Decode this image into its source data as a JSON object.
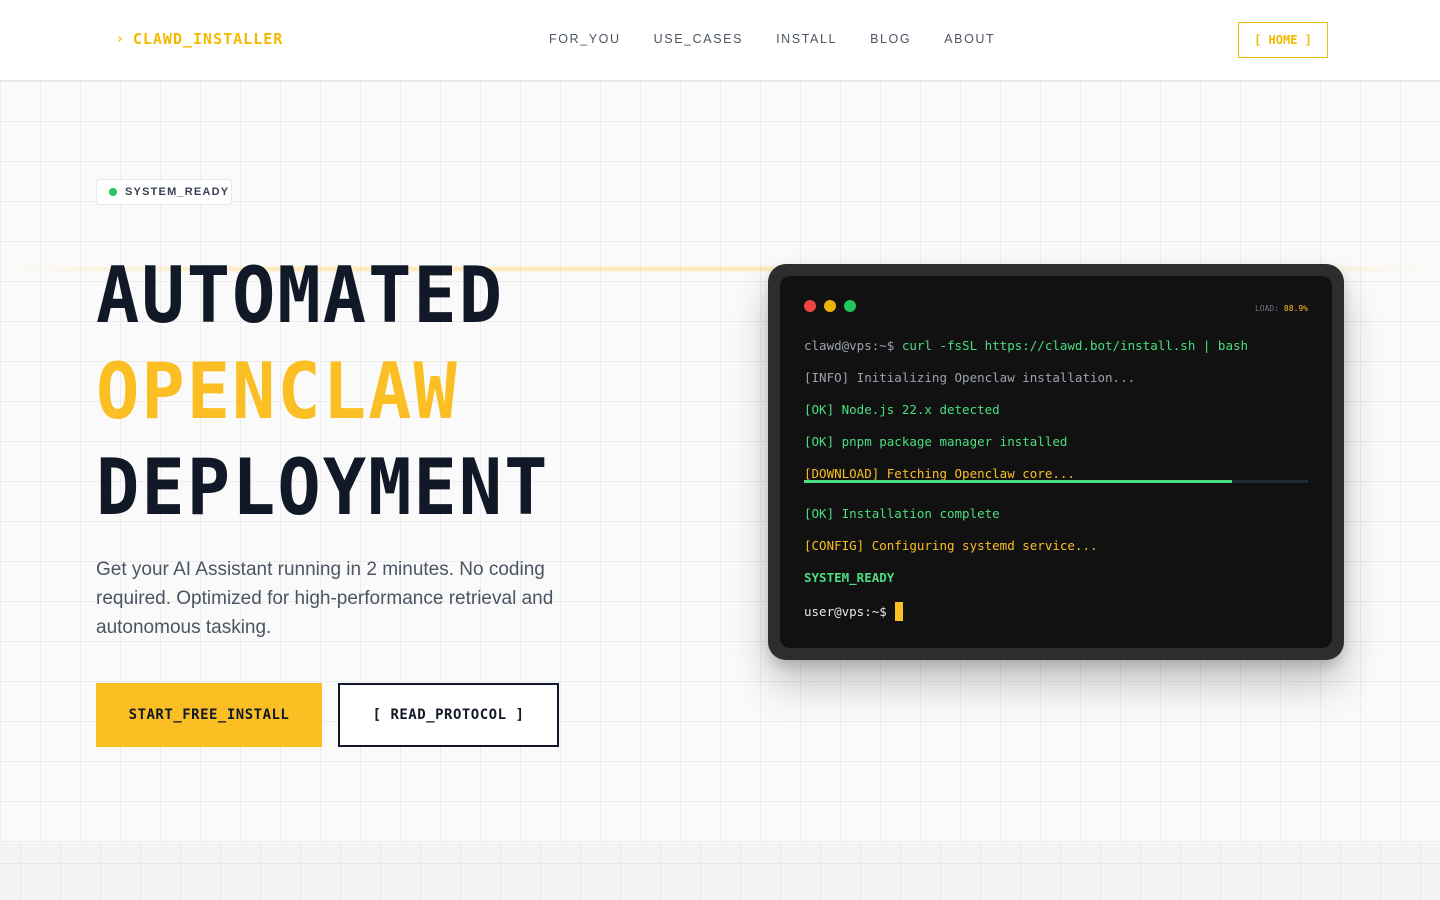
{
  "header": {
    "logo_chevron": "›",
    "logo_text": "CLAWD_INSTALLER",
    "nav": [
      {
        "label": "FOR_YOU"
      },
      {
        "label": "USE_CASES"
      },
      {
        "label": "INSTALL"
      },
      {
        "label": "BLOG"
      },
      {
        "label": "ABOUT"
      }
    ],
    "home_button": "[ HOME ]"
  },
  "hero": {
    "status_badge": "SYSTEM_READY",
    "headline": [
      "AUTOMATED",
      "OPENCLAW",
      "DEPLOYMENT"
    ],
    "subtitle": "Get your AI Assistant running in 2 minutes. No coding required. Optimized for high-performance retrieval and autonomous tasking.",
    "primary_cta": "START_FREE_INSTALL",
    "secondary_cta": "[ READ_PROTOCOL ]"
  },
  "terminal": {
    "load_label": "LOAD:",
    "load_value": "88.9%",
    "prompt": "clawd@vps:~$",
    "command": "curl -fsSL https://clawd.bot/install.sh | bash",
    "lines": [
      {
        "text": "[INFO] Initializing Openclaw installation...",
        "color": "gray"
      },
      {
        "text": "[OK] Node.js 22.x detected",
        "color": "green"
      },
      {
        "text": "[OK] pnpm package manager installed",
        "color": "green"
      },
      {
        "text": "[DOWNLOAD] Fetching Openclaw core...",
        "color": "amber"
      }
    ],
    "progress": 0.85,
    "lines_after": [
      {
        "text": "[OK] Installation complete",
        "color": "green"
      },
      {
        "text": "[CONFIG] Configuring systemd service...",
        "color": "amber"
      },
      {
        "text": "SYSTEM_READY",
        "color": "green"
      }
    ],
    "final_prompt": "user@vps:~$",
    "colors": {
      "green": "#4ade80",
      "amber": "#fbbf24",
      "gray": "#9ca3af"
    }
  },
  "colors": {
    "accent": "#fbbf24",
    "text_dark": "#111827",
    "status_green": "#22c55e"
  }
}
